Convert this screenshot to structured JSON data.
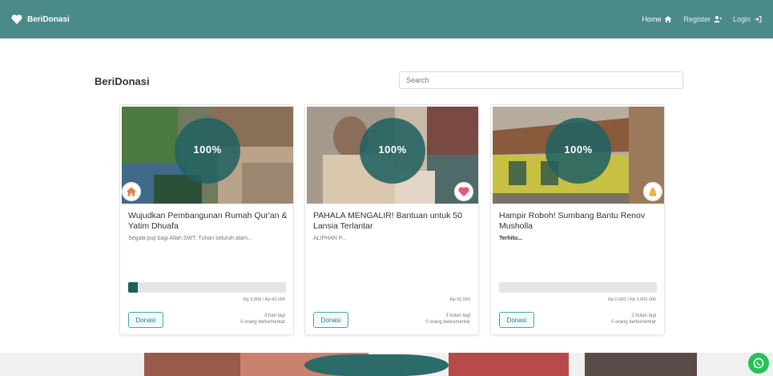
{
  "navbar": {
    "brand": "BeriDonasi",
    "links": [
      {
        "label": "Home",
        "icon": "home-icon",
        "active": true
      },
      {
        "label": "Register",
        "icon": "user-plus-icon",
        "active": false
      },
      {
        "label": "Login",
        "icon": "sign-in-icon",
        "active": false
      }
    ]
  },
  "main": {
    "title": "BeriDonasi",
    "search_placeholder": "Search"
  },
  "campaigns": [
    {
      "title": "Wujudkan Pembangunan Rumah Qur'an & Yatim Dhuafa",
      "description": "Segala puji bagi Allah SWT. Tuhan seluruh alam...",
      "badge_icon": "home-icon",
      "progress": 0.06,
      "amount": "Rp 3.808 / Rp 60.000",
      "days_left": "3 hari lagi",
      "comments": "0 orang berkomentar",
      "donate_label": "Donasi"
    },
    {
      "title": "PAHALA MENGALIR! Bantuan untuk 50 Lansia Terlantar",
      "description": "ALIPHAN P...",
      "badge_icon": "heart-icon",
      "progress": null,
      "amount": "Rp 50.000",
      "days_left": "3 bulan lagi",
      "comments": "0 orang berkomentar",
      "donate_label": "Donasi"
    },
    {
      "title": "Hampir Roboh! Sumbang Bantu Renov Musholla",
      "description": "Terhitu...",
      "badge_icon": "mosque-icon",
      "progress": 0,
      "amount": "Rp 0.000 / Rp 3.000.000",
      "days_left": "2 bulan lagi",
      "comments": "0 orang berkomentar",
      "donate_label": "Donasi"
    }
  ],
  "colors": {
    "navbar": "#4a8a88",
    "progress_fill": "#1f5f5f",
    "button_border": "#4aa3a3",
    "whatsapp": "#25c356"
  }
}
